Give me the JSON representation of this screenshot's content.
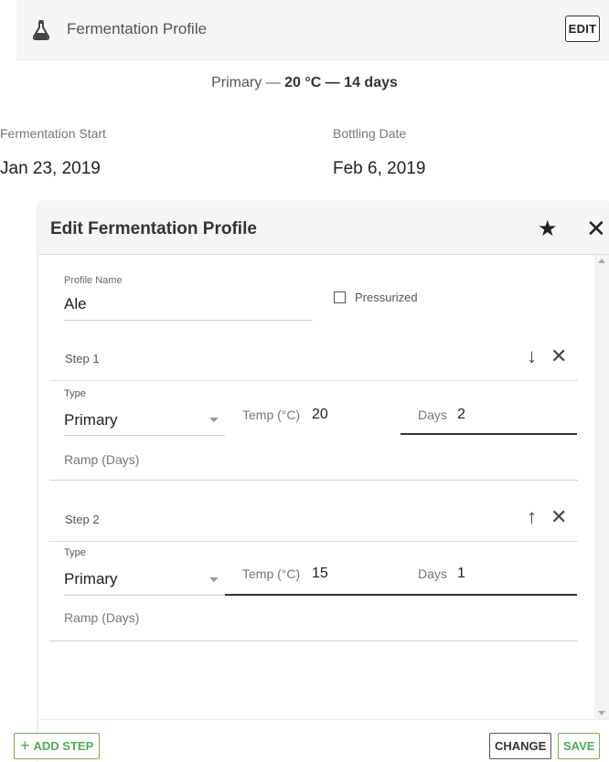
{
  "card": {
    "title": "Fermentation Profile",
    "edit_label": "EDIT",
    "summary_prefix": "Primary — ",
    "summary_bold": "20 °C — 14 days",
    "fermentation_start_label": "Fermentation Start",
    "fermentation_start_value": "Jan 23, 2019",
    "bottling_date_label": "Bottling Date",
    "bottling_date_value": "Feb 6, 2019"
  },
  "dialog": {
    "title": "Edit Fermentation Profile",
    "profile_name_label": "Profile Name",
    "profile_name_value": "Ale",
    "pressurized_label": "Pressurized",
    "pressurized_checked": false,
    "steps": [
      {
        "title": "Step 1",
        "move_icon": "arrow-down-icon",
        "move_glyph": "↓",
        "remove_glyph": "✕",
        "type_label": "Type",
        "type_value": "Primary",
        "temp_label": "Temp (°C)",
        "temp_value": "20",
        "days_label": "Days",
        "days_value": "2",
        "ramp_label": "Ramp (Days)"
      },
      {
        "title": "Step 2",
        "move_icon": "arrow-up-icon",
        "move_glyph": "↑",
        "remove_glyph": "✕",
        "type_label": "Type",
        "type_value": "Primary",
        "temp_label": "Temp (°C)",
        "temp_value": "15",
        "days_label": "Days",
        "days_value": "1",
        "ramp_label": "Ramp (Days)"
      }
    ],
    "add_step_plus": "+",
    "add_step_label": "ADD STEP",
    "change_label": "CHANGE",
    "save_label": "SAVE",
    "star_glyph": "★",
    "close_glyph": "✕"
  },
  "colors": {
    "accent_green": "#4caf50",
    "header_bg": "#f5f5f5",
    "text_dark": "#212121"
  }
}
